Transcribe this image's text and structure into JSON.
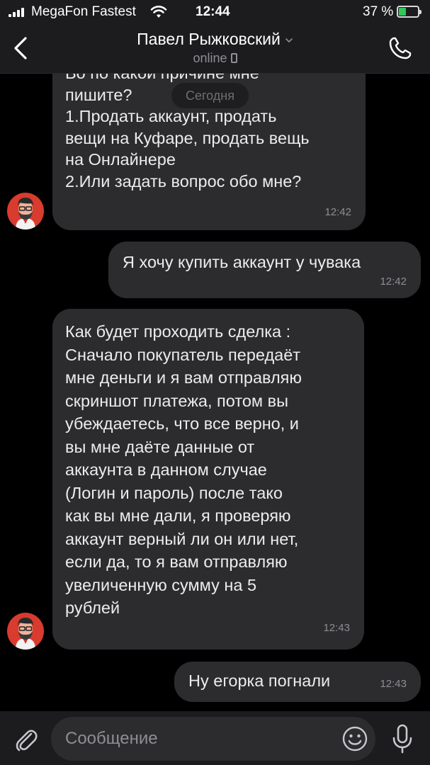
{
  "status_bar": {
    "carrier": "MegaFon Fastest",
    "time": "12:44",
    "battery_percent": "37 %",
    "battery_level": 0.37
  },
  "header": {
    "contact_name": "Павел Рыжковский",
    "presence": "online"
  },
  "chat": {
    "date_separator": "Сегодня",
    "messages": [
      {
        "direction": "in",
        "text": "Во по какой причине мне\nпишите?\n1.Продать аккаунт, продать\nвещи на Куфаре, продать вещь\nна Онлайнере\n2.Или задать вопрос обо мне?",
        "time": "12:42"
      },
      {
        "direction": "out",
        "text": "Я хочу купить аккаунт у чувака",
        "time": "12:42"
      },
      {
        "direction": "in",
        "text": "Как будет проходить сделка :\nСначало покупатель передаёт\nмне деньги и я вам отправляю\nскриншот платежа, потом вы\nубеждаетесь, что все верно, и\nвы мне даёте данные от\nаккаунта в данном случае\n(Логин и пароль) после тако\nкак вы мне дали, я проверяю\nаккаунт верный ли он или нет,\nесли да, то я вам отправляю\nувеличенную сумму на 5\nрублей",
        "time": "12:43"
      },
      {
        "direction": "out",
        "text": "Ну егорка погнали",
        "time": "12:43"
      }
    ]
  },
  "input": {
    "placeholder": "Сообщение",
    "value": ""
  },
  "icons": {
    "back": "chevron-left-icon",
    "call": "phone-icon",
    "attach": "paperclip-icon",
    "emoji": "smiley-icon",
    "voice": "microphone-icon"
  },
  "colors": {
    "background": "#000000",
    "bar": "#1c1c1e",
    "bubble": "#2c2c2e",
    "accent_battery": "#34c759",
    "avatar": "#d93b2f"
  }
}
